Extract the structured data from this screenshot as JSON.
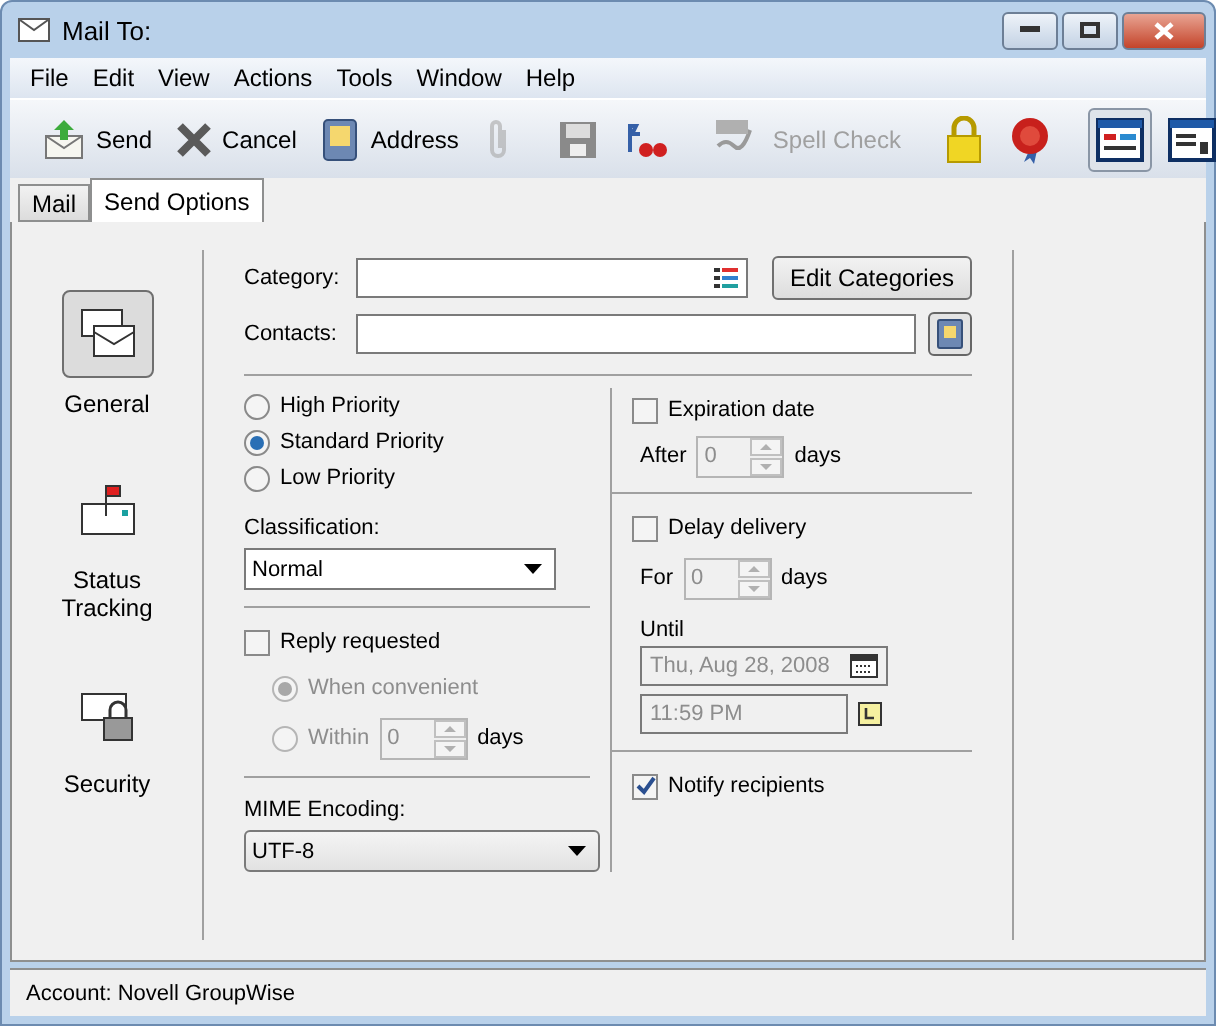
{
  "window": {
    "title": "Mail To:"
  },
  "menu": [
    "File",
    "Edit",
    "View",
    "Actions",
    "Tools",
    "Window",
    "Help"
  ],
  "toolbar": [
    {
      "kind": "button",
      "label": "Send",
      "disabled": false,
      "pressed": false
    },
    {
      "kind": "button",
      "label": "Cancel",
      "disabled": false,
      "pressed": false
    },
    {
      "kind": "button",
      "label": "Address",
      "disabled": false,
      "pressed": false
    },
    {
      "kind": "icon",
      "disabled": true,
      "pressed": false
    },
    {
      "kind": "separator"
    },
    {
      "kind": "icon",
      "disabled": false,
      "pressed": false
    },
    {
      "kind": "icon",
      "disabled": false,
      "pressed": false
    },
    {
      "kind": "separator"
    },
    {
      "kind": "button",
      "label": "Spell Check",
      "disabled": true,
      "pressed": false
    },
    {
      "kind": "separator"
    },
    {
      "kind": "icon",
      "disabled": false,
      "pressed": false
    },
    {
      "kind": "icon",
      "disabled": false,
      "pressed": false
    },
    {
      "kind": "separator"
    },
    {
      "kind": "icon",
      "disabled": false,
      "pressed": true
    },
    {
      "kind": "icon",
      "disabled": false,
      "pressed": false
    }
  ],
  "tabs": [
    {
      "label": "Mail",
      "selected": false
    },
    {
      "label": "Send Options",
      "selected": true
    }
  ],
  "nav": [
    {
      "label": "General",
      "selected": true
    },
    {
      "label": "Status Tracking",
      "selected": false
    },
    {
      "label": "Security",
      "selected": false
    }
  ],
  "category": {
    "label": "Category:",
    "button": "Edit Categories"
  },
  "contacts": {
    "label": "Contacts:"
  },
  "priority": [
    {
      "label": "High Priority",
      "selected": false
    },
    {
      "label": "Standard Priority",
      "selected": true
    },
    {
      "label": "Low Priority",
      "selected": false
    }
  ],
  "classification": {
    "label": "Classification:",
    "value": "Normal"
  },
  "reply": {
    "label": "Reply requested",
    "checked": false,
    "options": [
      {
        "label": "When convenient",
        "selected": true,
        "disabled": true
      },
      {
        "label": "Within",
        "selected": false,
        "disabled": true,
        "value": "0",
        "unit": "days"
      }
    ]
  },
  "mime": {
    "label": "MIME Encoding:",
    "value": "UTF-8"
  },
  "expiration": {
    "label": "Expiration date",
    "checked": false,
    "prefix": "After",
    "value": "0",
    "unit": "days"
  },
  "delay": {
    "label": "Delay delivery",
    "checked": false,
    "prefix": "For",
    "value": "0",
    "unit": "days",
    "until_label": "Until",
    "date": "Thu, Aug 28, 2008",
    "time": "11:59 PM"
  },
  "notify": {
    "label": "Notify recipients",
    "checked": true
  },
  "status_bar": "Account: Novell GroupWise"
}
